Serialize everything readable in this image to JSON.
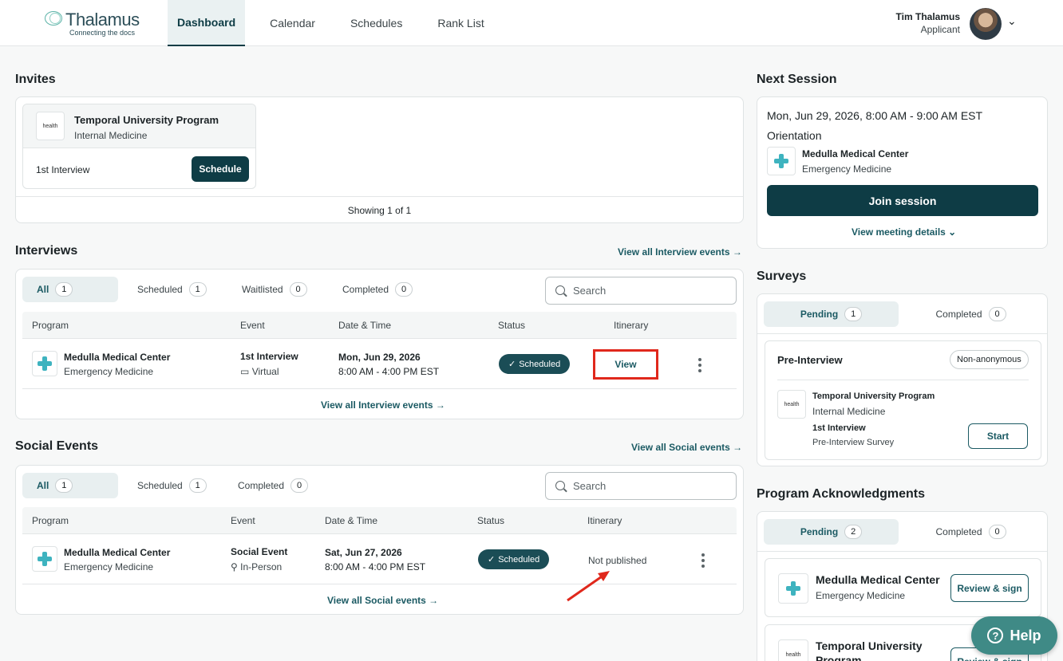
{
  "header": {
    "logo_name": "Thalamus",
    "logo_tagline": "Connecting the docs",
    "nav": [
      "Dashboard",
      "Calendar",
      "Schedules",
      "Rank List"
    ],
    "active_nav": "Dashboard",
    "user_name": "Tim Thalamus",
    "user_role": "Applicant"
  },
  "invites": {
    "title": "Invites",
    "program": "Temporal University Program",
    "specialty": "Internal Medicine",
    "logo_text": "health",
    "event": "1st Interview",
    "button": "Schedule",
    "showing": "Showing 1 of 1"
  },
  "interviews": {
    "title": "Interviews",
    "view_all_top": "View all Interview events →",
    "tabs": [
      {
        "label": "All",
        "count": "1"
      },
      {
        "label": "Scheduled",
        "count": "1"
      },
      {
        "label": "Waitlisted",
        "count": "0"
      },
      {
        "label": "Completed",
        "count": "0"
      }
    ],
    "search_placeholder": "Search",
    "columns": [
      "Program",
      "Event",
      "Date & Time",
      "Status",
      "Itinerary"
    ],
    "row": {
      "program": "Medulla Medical Center",
      "specialty": "Emergency Medicine",
      "event": "1st Interview",
      "event_type": "Virtual",
      "date": "Mon, Jun 29, 2026",
      "time": "8:00 AM - 4:00 PM EST",
      "status": "Scheduled",
      "itinerary": "View"
    },
    "view_all_bottom": "View all Interview events →"
  },
  "social": {
    "title": "Social Events",
    "view_all_top": "View all Social events →",
    "tabs": [
      {
        "label": "All",
        "count": "1"
      },
      {
        "label": "Scheduled",
        "count": "1"
      },
      {
        "label": "Completed",
        "count": "0"
      }
    ],
    "search_placeholder": "Search",
    "columns": [
      "Program",
      "Event",
      "Date & Time",
      "Status",
      "Itinerary"
    ],
    "row": {
      "program": "Medulla Medical Center",
      "specialty": "Emergency Medicine",
      "event": "Social Event",
      "event_type": "In-Person",
      "date": "Sat, Jun 27, 2026",
      "time": "8:00 AM - 4:00 PM EST",
      "status": "Scheduled",
      "itinerary": "Not published"
    },
    "view_all_bottom": "View all Social events →"
  },
  "next_session": {
    "title": "Next Session",
    "datetime": "Mon, Jun 29, 2026, 8:00 AM - 9:00 AM EST",
    "session_name": "Orientation",
    "program": "Medulla Medical Center",
    "specialty": "Emergency Medicine",
    "join": "Join session",
    "details": "View meeting details"
  },
  "surveys": {
    "title": "Surveys",
    "tabs": [
      {
        "label": "Pending",
        "count": "1"
      },
      {
        "label": "Completed",
        "count": "0"
      }
    ],
    "survey_title": "Pre-Interview",
    "anon": "Non-anonymous",
    "program": "Temporal University Program",
    "specialty": "Internal Medicine",
    "event": "1st Interview",
    "survey_name": "Pre-Interview Survey",
    "start": "Start"
  },
  "acknowledgments": {
    "title": "Program Acknowledgments",
    "tabs": [
      {
        "label": "Pending",
        "count": "2"
      },
      {
        "label": "Completed",
        "count": "0"
      }
    ],
    "items": [
      {
        "program": "Medulla Medical Center",
        "specialty": "Emergency Medicine",
        "button": "Review & sign"
      },
      {
        "program": "Temporal University",
        "program_line2": "Program",
        "button": "Review & sign"
      }
    ]
  },
  "help": "Help",
  "colors": {
    "primary": "#0e3c45",
    "accent": "#1b5a63",
    "annotation_red": "#e0281c",
    "help": "#3f8a86"
  }
}
